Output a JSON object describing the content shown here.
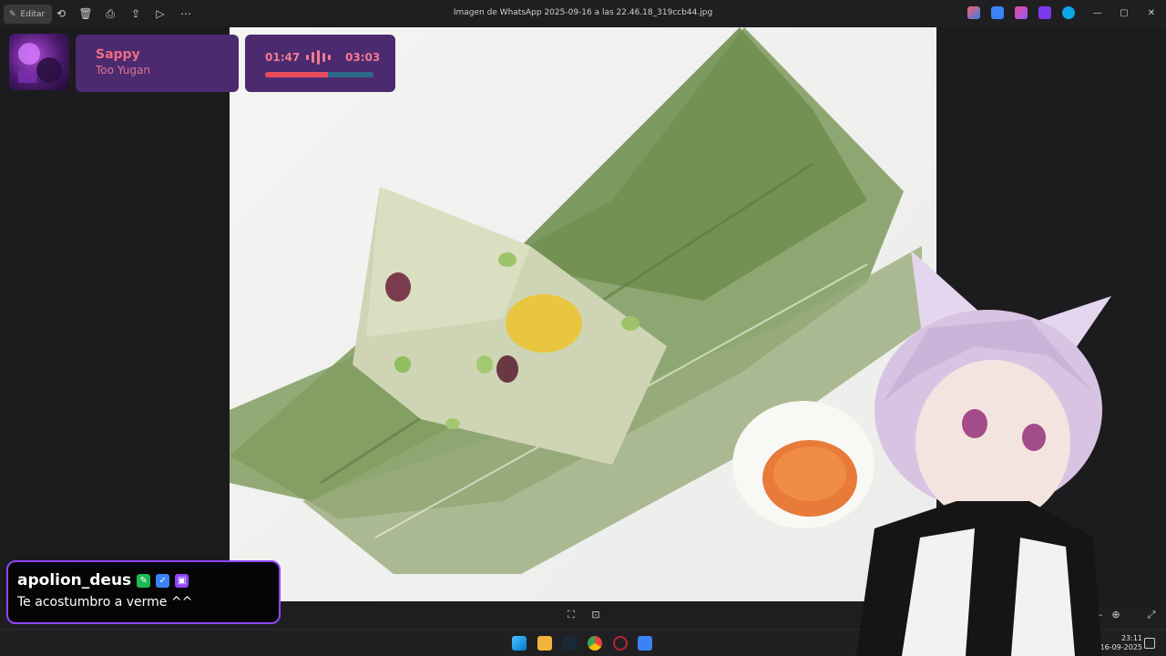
{
  "window": {
    "title": "Imagen de WhatsApp 2025-09-16 a las 22.46.18_319ccb44.jpg",
    "edit_label": "Editar"
  },
  "toolbar_icons": [
    "rotate-icon",
    "delete-icon",
    "print-icon",
    "share-icon",
    "slideshow-icon",
    "more-icon"
  ],
  "colors": {
    "music_card": "#4b2a6f",
    "music_text": "#f37b8e",
    "progress_played": "#e74c5c",
    "progress_remaining": "#2d6a8a",
    "chat_border": "#9146ff"
  },
  "music": {
    "title": "Sappy",
    "artist": "Too Yugan",
    "current_time": "01:47",
    "total_time": "03:03",
    "progress": 0.58
  },
  "chat": {
    "username": "apolion_deus",
    "message": "Te acostumbro a verme ^^"
  },
  "taskbar": {
    "time": "23:11",
    "date": "16-09-2025"
  }
}
